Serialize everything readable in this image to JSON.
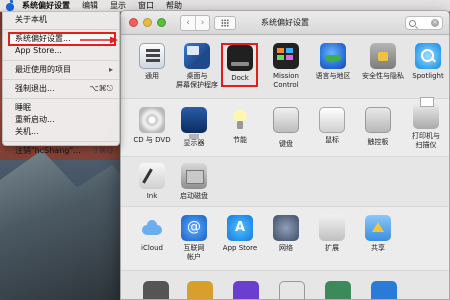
{
  "menubar": {
    "items": [
      "系统偏好设置",
      "编辑",
      "显示",
      "窗口",
      "帮助"
    ]
  },
  "apple_menu": {
    "about": "关于本机",
    "system_prefs": "系统偏好设置...",
    "app_store": "App Store...",
    "recent_items": "最近使用的项目",
    "force_quit": "强制退出...",
    "force_quit_shortcut": "⌥⌘⎋",
    "sleep": "睡眠",
    "restart": "重新启动...",
    "shutdown": "关机...",
    "logout": "注销\"hcShang\"...",
    "logout_shortcut": "⇧⌘Q"
  },
  "window": {
    "title": "系统偏好设置",
    "colors": {
      "highlight_frame": "#e02020"
    }
  },
  "panes": {
    "general": "通用",
    "desktop": "桌面与\n屏幕保护程序",
    "dock": "Dock",
    "mission_control": "Mission\nControl",
    "language": "语言与地区",
    "security": "安全性与隐私",
    "spotlight": "Spotlight",
    "cd_dvd": "CD 与 DVD",
    "displays": "显示器",
    "energy": "节能",
    "keyboard": "键盘",
    "mouse": "鼠标",
    "trackpad": "触控板",
    "printers": "打印机与\n扫描仪",
    "ink": "Ink",
    "startup_disk": "启动磁盘",
    "icloud": "iCloud",
    "internet_accounts": "互联网\n帐户",
    "app_store": "App Store",
    "network": "网络",
    "extensions": "扩展",
    "sharing": "共享"
  }
}
